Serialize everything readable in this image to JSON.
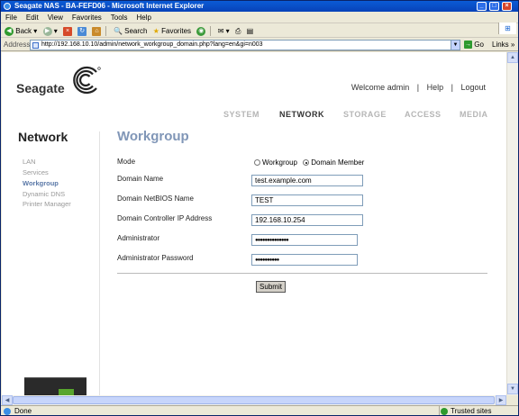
{
  "window": {
    "title": "Seagate NAS - BA-FEFD06 - Microsoft Internet Explorer"
  },
  "menu": [
    "File",
    "Edit",
    "View",
    "Favorites",
    "Tools",
    "Help"
  ],
  "toolbar": {
    "back": "Back",
    "search": "Search",
    "favorites": "Favorites"
  },
  "address": {
    "label": "Address",
    "url": "http://192.168.10.10/admin/network_workgroup_domain.php?lang=en&gi=n003",
    "go": "Go",
    "links": "Links"
  },
  "status": {
    "text": "Done",
    "zone": "Trusted sites"
  },
  "header": {
    "logo": "Seagate",
    "welcome": "Welcome admin",
    "sep": "|",
    "help": "Help",
    "logout": "Logout"
  },
  "nav": {
    "system": "SYSTEM",
    "network": "NETWORK",
    "storage": "STORAGE",
    "access": "ACCESS",
    "media": "MEDIA"
  },
  "sidebar": {
    "title": "Network",
    "items": [
      "LAN",
      "Services",
      "Workgroup",
      "Dynamic DNS",
      "Printer Manager"
    ]
  },
  "form": {
    "title": "Workgroup",
    "mode_label": "Mode",
    "mode_options": [
      "Workgroup",
      "Domain Member"
    ],
    "mode_selected": "Domain Member",
    "domain_name_label": "Domain Name",
    "domain_name_value": "test.example.com",
    "netbios_label": "Domain NetBIOS Name",
    "netbios_value": "TEST",
    "dc_ip_label": "Domain Controller IP Address",
    "dc_ip_value": "192.168.10.254",
    "admin_label": "Administrator",
    "admin_value": "●●●●●●●●●●●●●●",
    "admin_password_label": "Administrator Password",
    "admin_password_value": "●●●●●●●●●●",
    "submit": "Submit"
  }
}
